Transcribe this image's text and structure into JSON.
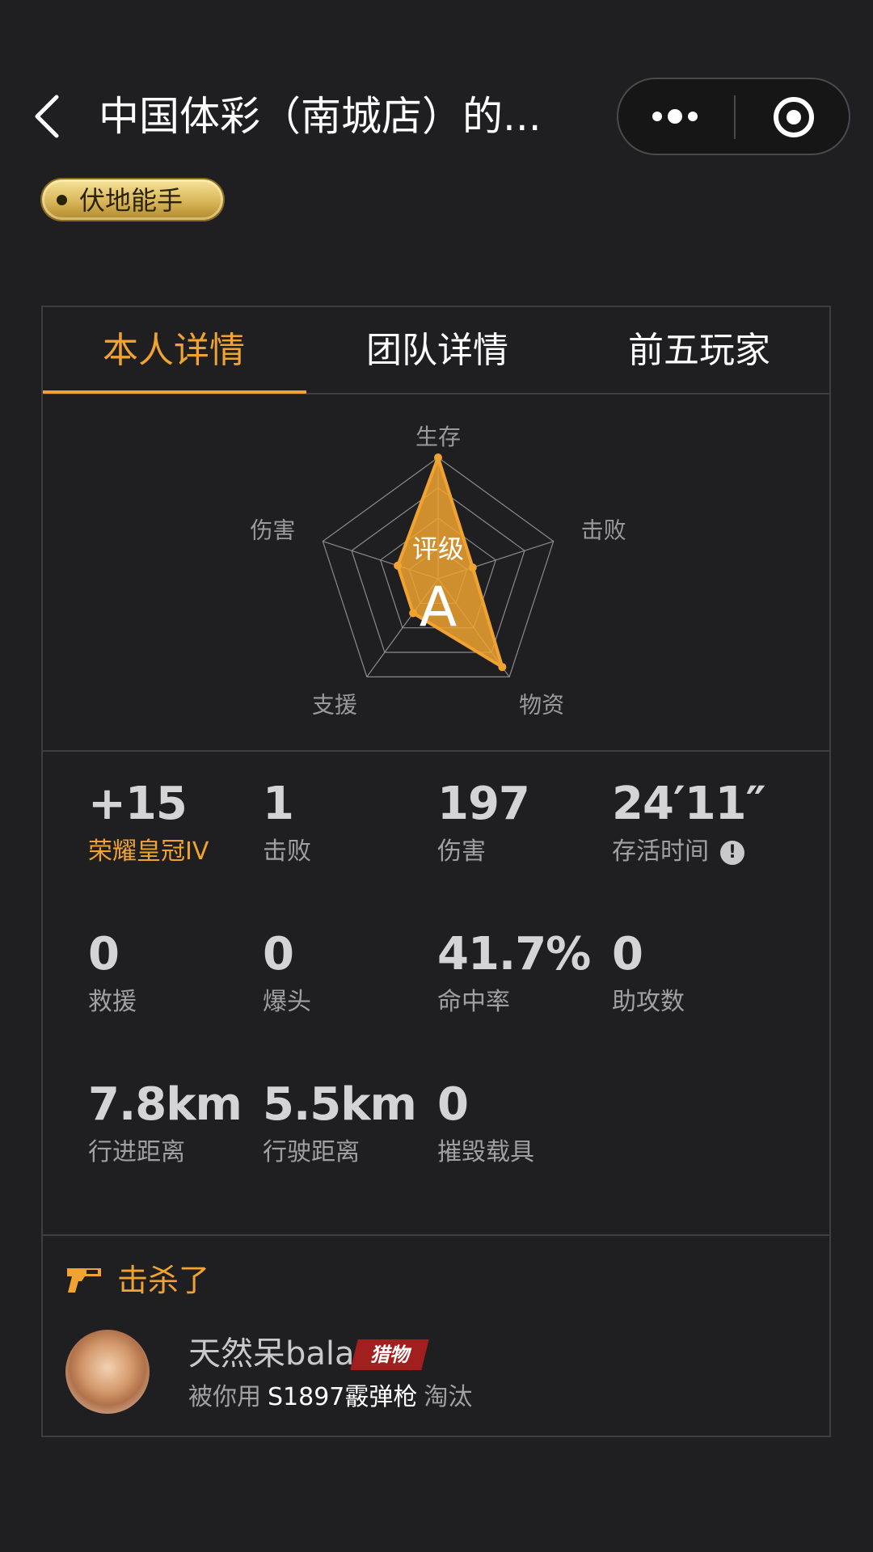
{
  "header": {
    "title": "中国体彩（南城店）的..."
  },
  "badge": {
    "label": "伏地能手"
  },
  "tabs": [
    {
      "label": "本人详情",
      "active": true
    },
    {
      "label": "团队详情",
      "active": false
    },
    {
      "label": "前五玩家",
      "active": false
    }
  ],
  "radar": {
    "axes": [
      "生存",
      "击败",
      "物资",
      "支援",
      "伤害"
    ],
    "values": [
      1.0,
      0.3,
      0.9,
      0.35,
      0.35
    ],
    "rating_label": "评级",
    "rating_grade": "A",
    "accent": "#f0a330"
  },
  "stats": [
    {
      "value": "+15",
      "label": "荣耀皇冠IV",
      "highlight": true
    },
    {
      "value": "1",
      "label": "击败"
    },
    {
      "value": "197",
      "label": "伤害"
    },
    {
      "value": "24′11″",
      "label": "存活时间",
      "info": true
    },
    {
      "value": "0",
      "label": "救援"
    },
    {
      "value": "0",
      "label": "爆头"
    },
    {
      "value": "41.7%",
      "label": "命中率"
    },
    {
      "value": "0",
      "label": "助攻数"
    },
    {
      "value": "7.8km",
      "label": "行进距离"
    },
    {
      "value": "5.5km",
      "label": "行驶距离"
    },
    {
      "value": "0",
      "label": "摧毁载具"
    }
  ],
  "kill": {
    "title": "击杀了",
    "victim_name": "天然呆bala",
    "victim_tag": "猎物",
    "prefix": "被你用",
    "weapon": "S1897霰弹枪",
    "suffix": "淘汰"
  },
  "icons": {
    "back": "chevron-left-icon",
    "more": "more-dots-icon",
    "close": "target-close-icon",
    "info": "info-icon",
    "gun": "pistol-icon"
  },
  "colors": {
    "background": "#1f1f21",
    "accent": "#f0a330",
    "tag": "#a21f1f"
  }
}
